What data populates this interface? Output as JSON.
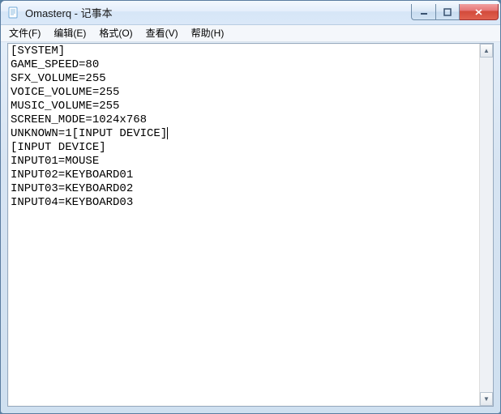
{
  "window": {
    "title": "Omasterq - 记事本"
  },
  "menubar": {
    "items": [
      {
        "label": "文件(F)"
      },
      {
        "label": "编辑(E)"
      },
      {
        "label": "格式(O)"
      },
      {
        "label": "查看(V)"
      },
      {
        "label": "帮助(H)"
      }
    ]
  },
  "editor": {
    "lines": [
      "[SYSTEM]",
      "GAME_SPEED=80",
      "SFX_VOLUME=255",
      "VOICE_VOLUME=255",
      "MUSIC_VOLUME=255",
      "SCREEN_MODE=1024x768",
      "UNKNOWN=1[INPUT DEVICE]",
      "[INPUT DEVICE]",
      "INPUT01=MOUSE",
      "INPUT02=KEYBOARD01",
      "INPUT03=KEYBOARD02",
      "INPUT04=KEYBOARD03"
    ],
    "caret_line": 6
  },
  "scroll": {
    "up_glyph": "▲",
    "down_glyph": "▼"
  }
}
